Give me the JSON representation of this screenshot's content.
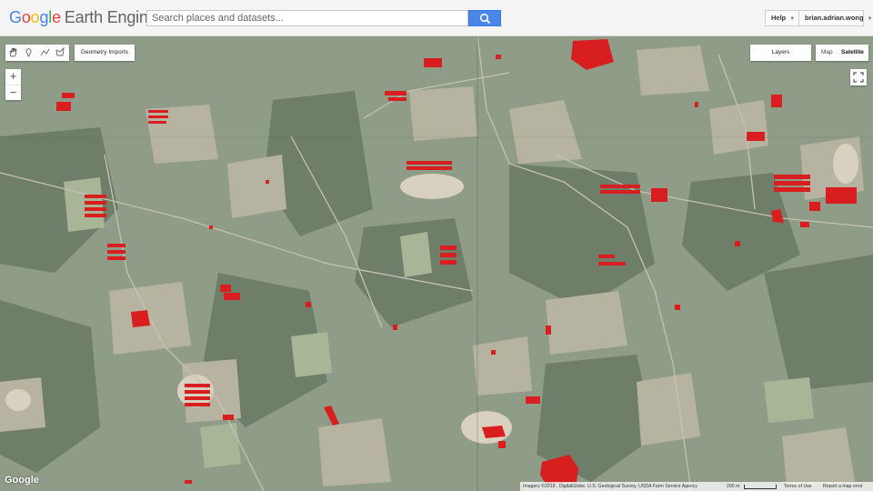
{
  "app": {
    "logo_google": "Google",
    "logo_product": "Earth Engine"
  },
  "search": {
    "placeholder": "Search places and datasets..."
  },
  "header": {
    "help_label": "Help",
    "account_label": "brian.adrian.wong"
  },
  "map": {
    "geometry_imports_label": "Geometry Imports",
    "zoom_in_label": "+",
    "zoom_out_label": "−",
    "layers_label": "Layers",
    "maptype_map_label": "Map",
    "maptype_satellite_label": "Satellite",
    "selected_maptype": "Satellite",
    "google_watermark": "Google",
    "attribution": "Imagery ©2018 , DigitalGlobe, U.S. Geological Survey, USDA Farm Service Agency",
    "scale_label": "200 m",
    "terms_label": "Terms of Use",
    "report_label": "Report a map error"
  },
  "tools": [
    "hand-tool-icon",
    "marker-tool-icon",
    "line-tool-icon",
    "polygon-tool-icon"
  ],
  "colors": {
    "overlay_red": "#d81e1e",
    "search_button": "#4a86e8",
    "forest": "#6d7d67",
    "field": "#b9b6a6"
  }
}
